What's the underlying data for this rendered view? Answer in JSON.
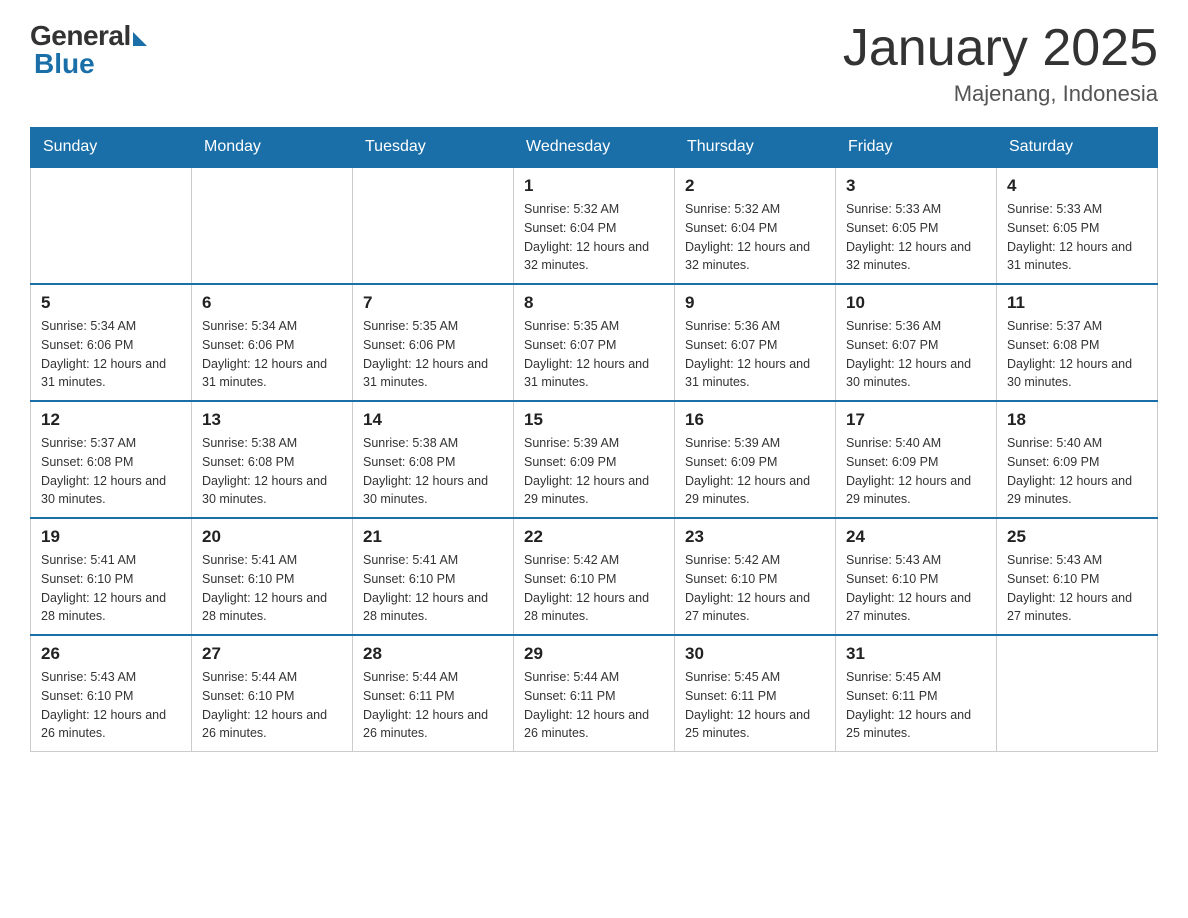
{
  "header": {
    "logo_general": "General",
    "logo_blue": "Blue",
    "title": "January 2025",
    "location": "Majenang, Indonesia"
  },
  "days_of_week": [
    "Sunday",
    "Monday",
    "Tuesday",
    "Wednesday",
    "Thursday",
    "Friday",
    "Saturday"
  ],
  "weeks": [
    [
      {
        "day": "",
        "info": ""
      },
      {
        "day": "",
        "info": ""
      },
      {
        "day": "",
        "info": ""
      },
      {
        "day": "1",
        "info": "Sunrise: 5:32 AM\nSunset: 6:04 PM\nDaylight: 12 hours and 32 minutes."
      },
      {
        "day": "2",
        "info": "Sunrise: 5:32 AM\nSunset: 6:04 PM\nDaylight: 12 hours and 32 minutes."
      },
      {
        "day": "3",
        "info": "Sunrise: 5:33 AM\nSunset: 6:05 PM\nDaylight: 12 hours and 32 minutes."
      },
      {
        "day": "4",
        "info": "Sunrise: 5:33 AM\nSunset: 6:05 PM\nDaylight: 12 hours and 31 minutes."
      }
    ],
    [
      {
        "day": "5",
        "info": "Sunrise: 5:34 AM\nSunset: 6:06 PM\nDaylight: 12 hours and 31 minutes."
      },
      {
        "day": "6",
        "info": "Sunrise: 5:34 AM\nSunset: 6:06 PM\nDaylight: 12 hours and 31 minutes."
      },
      {
        "day": "7",
        "info": "Sunrise: 5:35 AM\nSunset: 6:06 PM\nDaylight: 12 hours and 31 minutes."
      },
      {
        "day": "8",
        "info": "Sunrise: 5:35 AM\nSunset: 6:07 PM\nDaylight: 12 hours and 31 minutes."
      },
      {
        "day": "9",
        "info": "Sunrise: 5:36 AM\nSunset: 6:07 PM\nDaylight: 12 hours and 31 minutes."
      },
      {
        "day": "10",
        "info": "Sunrise: 5:36 AM\nSunset: 6:07 PM\nDaylight: 12 hours and 30 minutes."
      },
      {
        "day": "11",
        "info": "Sunrise: 5:37 AM\nSunset: 6:08 PM\nDaylight: 12 hours and 30 minutes."
      }
    ],
    [
      {
        "day": "12",
        "info": "Sunrise: 5:37 AM\nSunset: 6:08 PM\nDaylight: 12 hours and 30 minutes."
      },
      {
        "day": "13",
        "info": "Sunrise: 5:38 AM\nSunset: 6:08 PM\nDaylight: 12 hours and 30 minutes."
      },
      {
        "day": "14",
        "info": "Sunrise: 5:38 AM\nSunset: 6:08 PM\nDaylight: 12 hours and 30 minutes."
      },
      {
        "day": "15",
        "info": "Sunrise: 5:39 AM\nSunset: 6:09 PM\nDaylight: 12 hours and 29 minutes."
      },
      {
        "day": "16",
        "info": "Sunrise: 5:39 AM\nSunset: 6:09 PM\nDaylight: 12 hours and 29 minutes."
      },
      {
        "day": "17",
        "info": "Sunrise: 5:40 AM\nSunset: 6:09 PM\nDaylight: 12 hours and 29 minutes."
      },
      {
        "day": "18",
        "info": "Sunrise: 5:40 AM\nSunset: 6:09 PM\nDaylight: 12 hours and 29 minutes."
      }
    ],
    [
      {
        "day": "19",
        "info": "Sunrise: 5:41 AM\nSunset: 6:10 PM\nDaylight: 12 hours and 28 minutes."
      },
      {
        "day": "20",
        "info": "Sunrise: 5:41 AM\nSunset: 6:10 PM\nDaylight: 12 hours and 28 minutes."
      },
      {
        "day": "21",
        "info": "Sunrise: 5:41 AM\nSunset: 6:10 PM\nDaylight: 12 hours and 28 minutes."
      },
      {
        "day": "22",
        "info": "Sunrise: 5:42 AM\nSunset: 6:10 PM\nDaylight: 12 hours and 28 minutes."
      },
      {
        "day": "23",
        "info": "Sunrise: 5:42 AM\nSunset: 6:10 PM\nDaylight: 12 hours and 27 minutes."
      },
      {
        "day": "24",
        "info": "Sunrise: 5:43 AM\nSunset: 6:10 PM\nDaylight: 12 hours and 27 minutes."
      },
      {
        "day": "25",
        "info": "Sunrise: 5:43 AM\nSunset: 6:10 PM\nDaylight: 12 hours and 27 minutes."
      }
    ],
    [
      {
        "day": "26",
        "info": "Sunrise: 5:43 AM\nSunset: 6:10 PM\nDaylight: 12 hours and 26 minutes."
      },
      {
        "day": "27",
        "info": "Sunrise: 5:44 AM\nSunset: 6:10 PM\nDaylight: 12 hours and 26 minutes."
      },
      {
        "day": "28",
        "info": "Sunrise: 5:44 AM\nSunset: 6:11 PM\nDaylight: 12 hours and 26 minutes."
      },
      {
        "day": "29",
        "info": "Sunrise: 5:44 AM\nSunset: 6:11 PM\nDaylight: 12 hours and 26 minutes."
      },
      {
        "day": "30",
        "info": "Sunrise: 5:45 AM\nSunset: 6:11 PM\nDaylight: 12 hours and 25 minutes."
      },
      {
        "day": "31",
        "info": "Sunrise: 5:45 AM\nSunset: 6:11 PM\nDaylight: 12 hours and 25 minutes."
      },
      {
        "day": "",
        "info": ""
      }
    ]
  ]
}
